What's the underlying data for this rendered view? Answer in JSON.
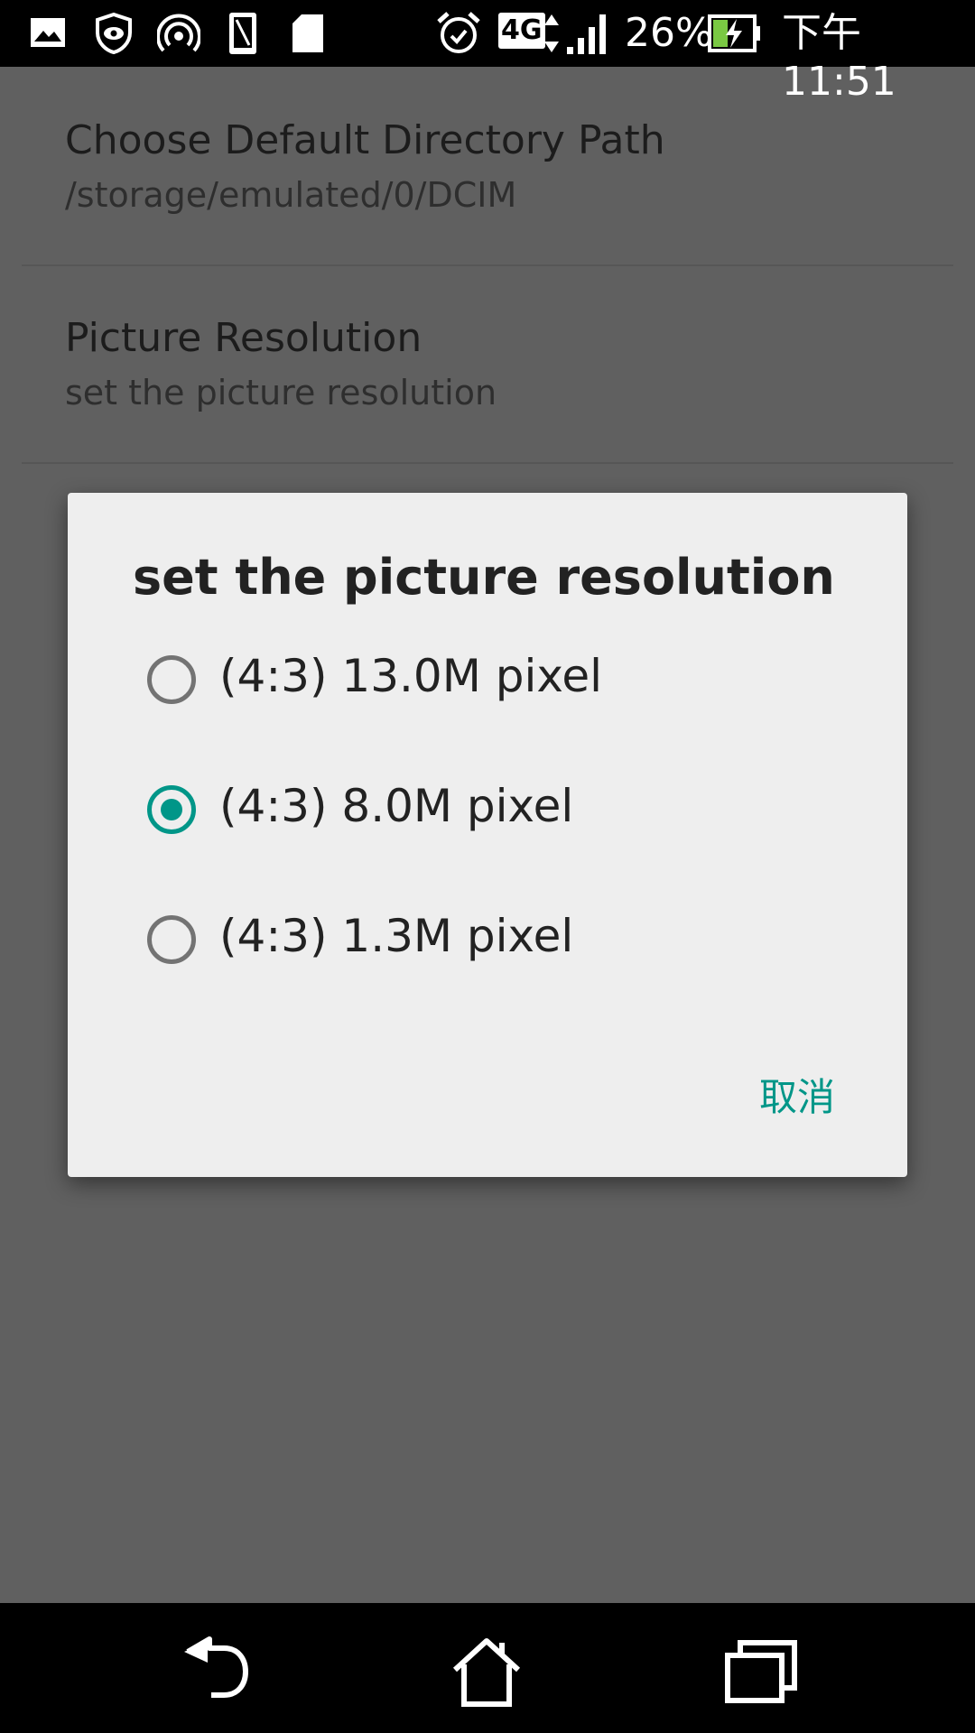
{
  "status_bar": {
    "network_type": "4G",
    "battery_percent": "26%",
    "time": "下午11:51",
    "icons": [
      "gallery-icon",
      "shield-eye-icon",
      "hotspot-icon",
      "phone-icon",
      "sd-card-icon",
      "alarm-icon",
      "signal-icon",
      "battery-charging-icon"
    ]
  },
  "settings": {
    "items": [
      {
        "title": "Choose Default Directory Path",
        "summary": "/storage/emulated/0/DCIM"
      },
      {
        "title": "Picture Resolution",
        "summary": "set the picture resolution"
      }
    ]
  },
  "dialog": {
    "title": "set the picture resolution",
    "options": [
      {
        "label": "(4:3) 13.0M pixel",
        "checked": false
      },
      {
        "label": "(4:3) 8.0M pixel",
        "checked": true
      },
      {
        "label": "(4:3) 1.3M pixel",
        "checked": false
      }
    ],
    "cancel_label": "取消"
  },
  "nav_bar": {
    "icons": [
      "back-icon",
      "home-icon",
      "recents-icon"
    ]
  },
  "colors": {
    "accent": "#009688",
    "scrim_background": "#606060",
    "dialog_background": "#eeeeee"
  }
}
